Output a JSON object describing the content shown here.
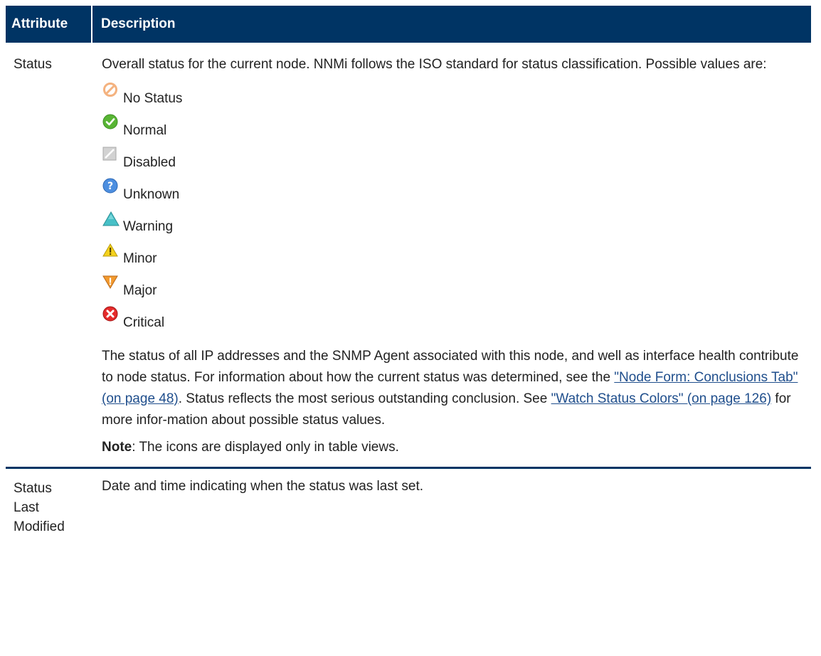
{
  "table": {
    "headers": {
      "attribute": "Attribute",
      "description": "Description"
    },
    "status_row": {
      "attribute": "Status",
      "intro": "Overall status for the current node. NNMi follows the ISO standard for status classification. Possible values are:",
      "statuses": [
        {
          "icon": "no-status-icon",
          "label": "No Status"
        },
        {
          "icon": "normal-icon",
          "label": "Normal"
        },
        {
          "icon": "disabled-icon",
          "label": "Disabled"
        },
        {
          "icon": "unknown-icon",
          "label": "Unknown"
        },
        {
          "icon": "warning-icon",
          "label": "Warning"
        },
        {
          "icon": "minor-icon",
          "label": "Minor"
        },
        {
          "icon": "major-icon",
          "label": "Major"
        },
        {
          "icon": "critical-icon",
          "label": "Critical"
        }
      ],
      "body": {
        "t1": "The status of all IP addresses and the SNMP Agent associated with this node, and well as interface health contribute to node status. For information about how the current status was determined, see the ",
        "link1": "\"Node Form: Conclusions Tab\" (on page 48)",
        "t2": ". Status reflects the most serious outstanding conclusion. See ",
        "link2": "\"Watch Status Colors\" (on page 126)",
        "t3": " for more infor-mation about possible status values."
      },
      "note_label": "Note",
      "note_text": ": The icons are displayed only in table views."
    },
    "modified_row": {
      "attribute_lines": [
        "Status",
        "Last",
        "Modified"
      ],
      "description": "Date and time indicating when the status was last set."
    }
  },
  "colors": {
    "header_bg": "#003464",
    "link": "#1f4e8c",
    "text": "#222222"
  }
}
